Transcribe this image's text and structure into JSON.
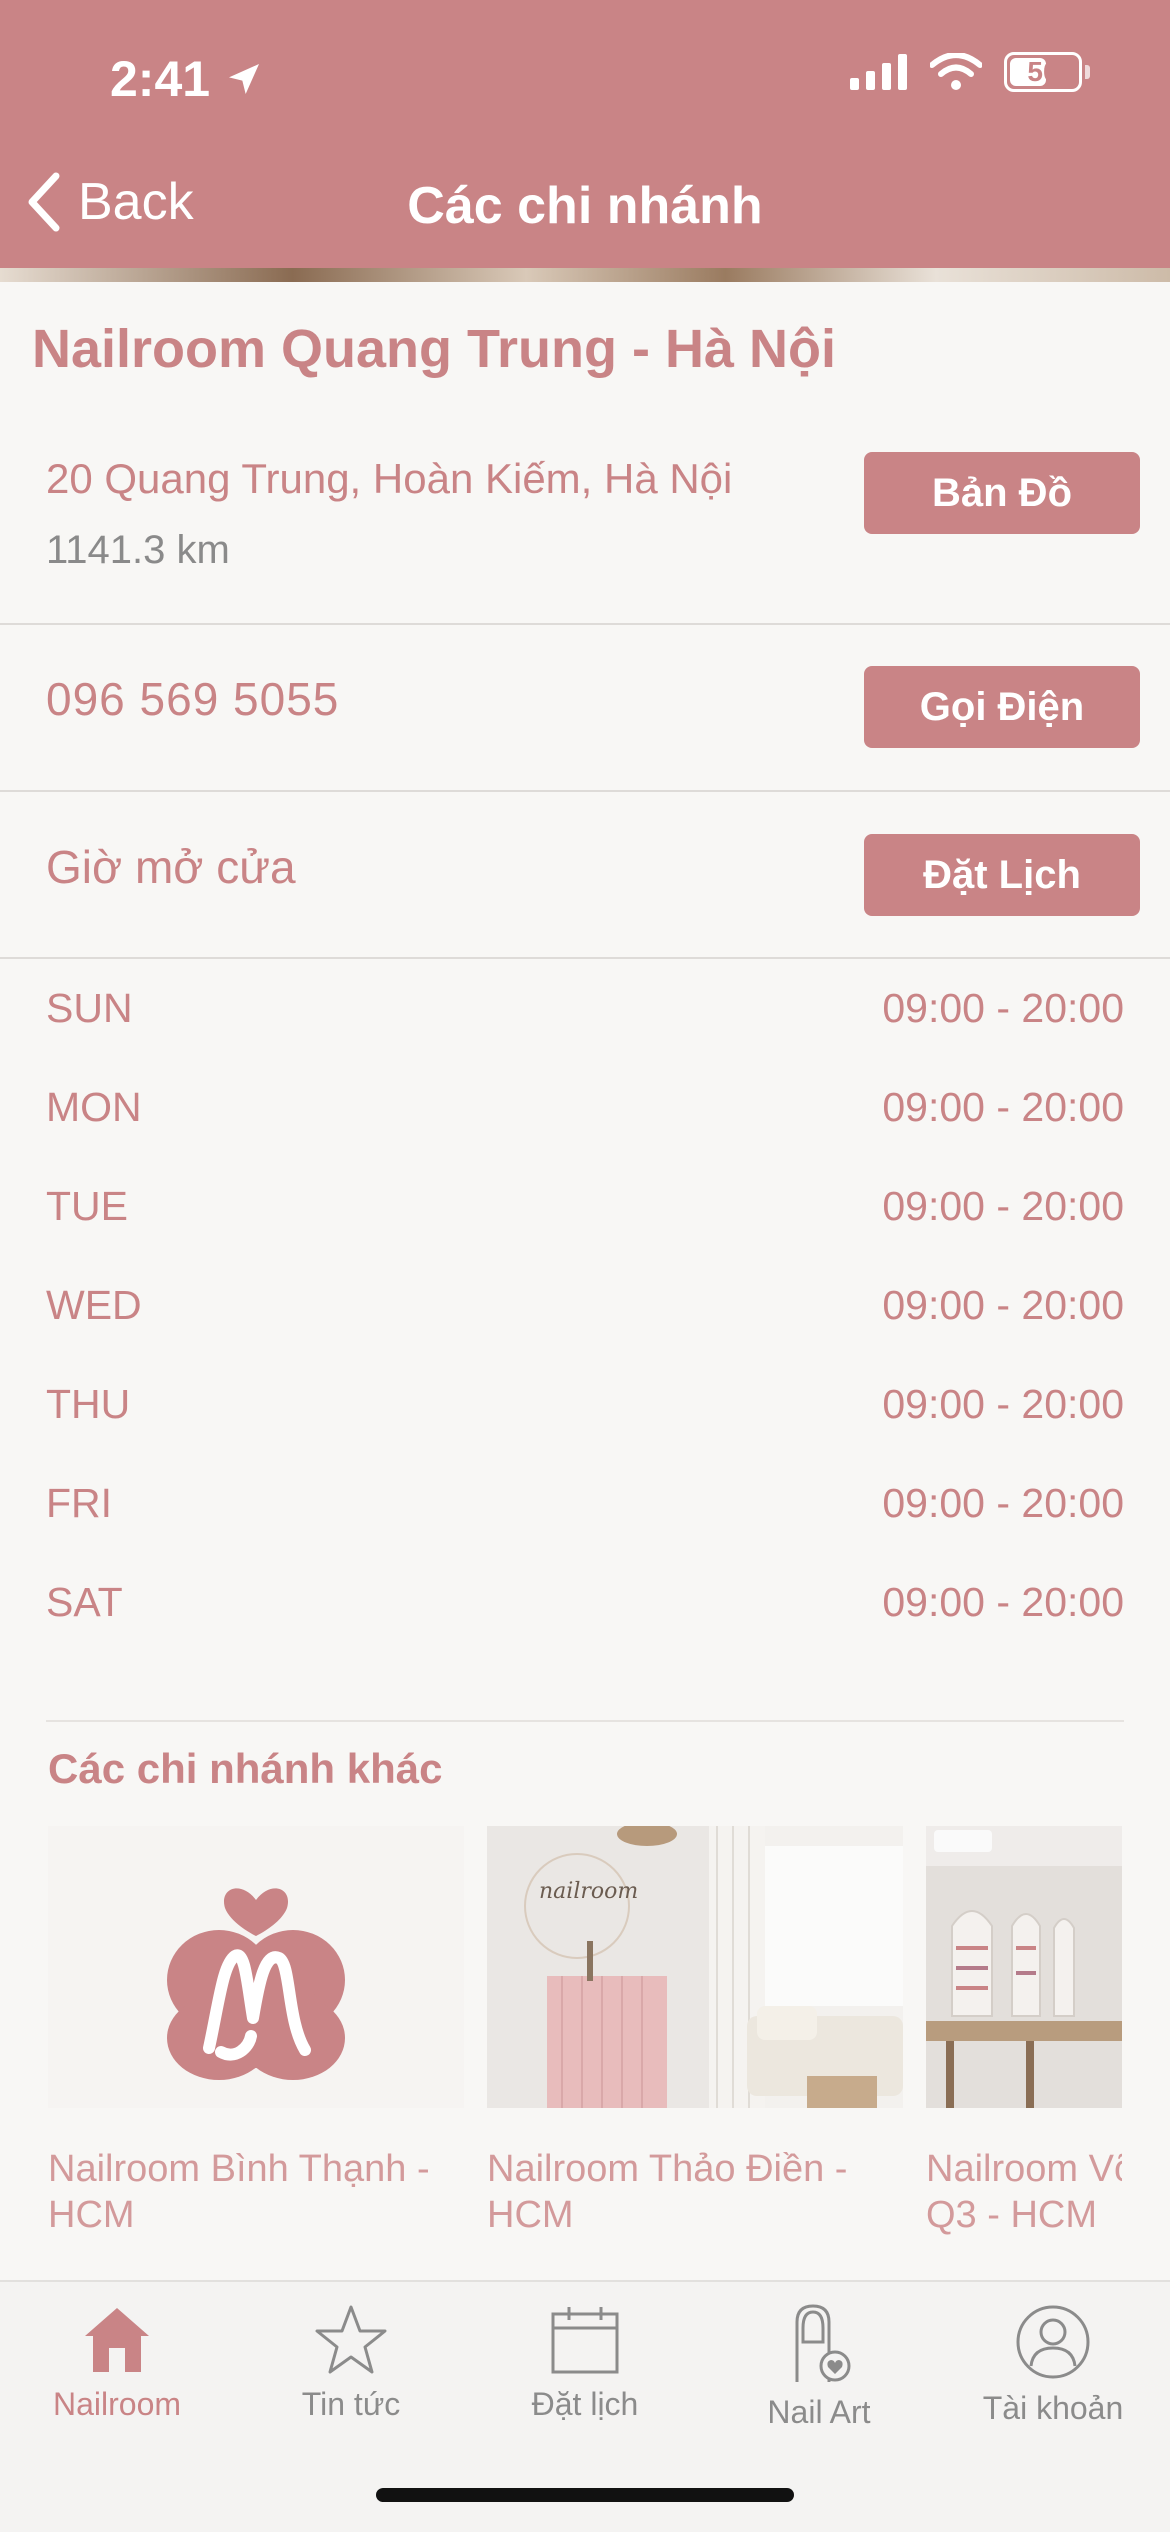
{
  "status": {
    "time": "2:41",
    "battery": "50"
  },
  "nav": {
    "back_label": "Back",
    "title": "Các chi nhánh"
  },
  "branch": {
    "name": "Nailroom Quang Trung - Hà Nội",
    "address": "20 Quang Trung, Hoàn Kiếm, Hà Nội",
    "distance": "1141.3 km",
    "map_button": "Bản Đồ",
    "phone": "096 569 5055",
    "call_button": "Gọi Điện",
    "hours_label": "Giờ mở cửa",
    "book_button": "Đặt Lịch",
    "hours": [
      {
        "day": "SUN",
        "time": "09:00 - 20:00"
      },
      {
        "day": "MON",
        "time": "09:00 - 20:00"
      },
      {
        "day": "TUE",
        "time": "09:00 - 20:00"
      },
      {
        "day": "WED",
        "time": "09:00 - 20:00"
      },
      {
        "day": "THU",
        "time": "09:00 - 20:00"
      },
      {
        "day": "FRI",
        "time": "09:00 - 20:00"
      },
      {
        "day": "SAT",
        "time": "09:00 - 20:00"
      }
    ]
  },
  "other": {
    "title": "Các chi nhánh khác",
    "branches": [
      {
        "line1": "Nailroom Bình Thạnh -",
        "line2": "HCM"
      },
      {
        "line1": "Nailroom Thảo Điền -",
        "line2": "HCM"
      },
      {
        "line1": "Nailroom Võ",
        "line2": "Q3 - HCM"
      }
    ]
  },
  "tabs": [
    {
      "label": "Nailroom",
      "icon": "home-icon",
      "active": true
    },
    {
      "label": "Tin tức",
      "icon": "star-icon",
      "active": false
    },
    {
      "label": "Đặt lịch",
      "icon": "calendar-icon",
      "active": false
    },
    {
      "label": "Nail Art",
      "icon": "nail-icon",
      "active": false
    },
    {
      "label": "Tài khoản",
      "icon": "user-icon",
      "active": false
    }
  ],
  "colors": {
    "accent": "#c98486",
    "background": "#f8f7f5",
    "muted": "#8a8a8a"
  }
}
